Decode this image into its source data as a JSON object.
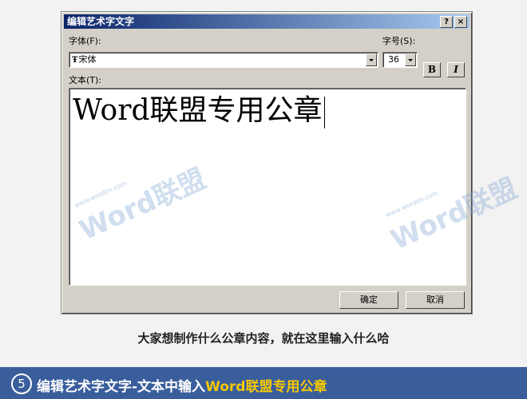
{
  "dialog": {
    "title": "编辑艺术字文字",
    "help_glyph": "?",
    "close_glyph": "×",
    "font_label": "字体(F):",
    "font_value": "宋体",
    "font_icon_glyph": "Ŧ",
    "size_label": "字号(S):",
    "size_value": "36",
    "bold_label": "B",
    "italic_label": "I",
    "text_label": "文本(T):",
    "text_value": "Word联盟专用公章",
    "ok_label": "确定",
    "cancel_label": "取消"
  },
  "watermark": {
    "brand": "Word联盟",
    "url": "www.wordlm.com"
  },
  "caption": "大家想制作什么公章内容，就在这里输入什么哈",
  "footer": {
    "step_number": "5",
    "text_prefix": "编辑艺术字文字-文本中输入",
    "text_highlight": "Word联盟专用公章"
  }
}
